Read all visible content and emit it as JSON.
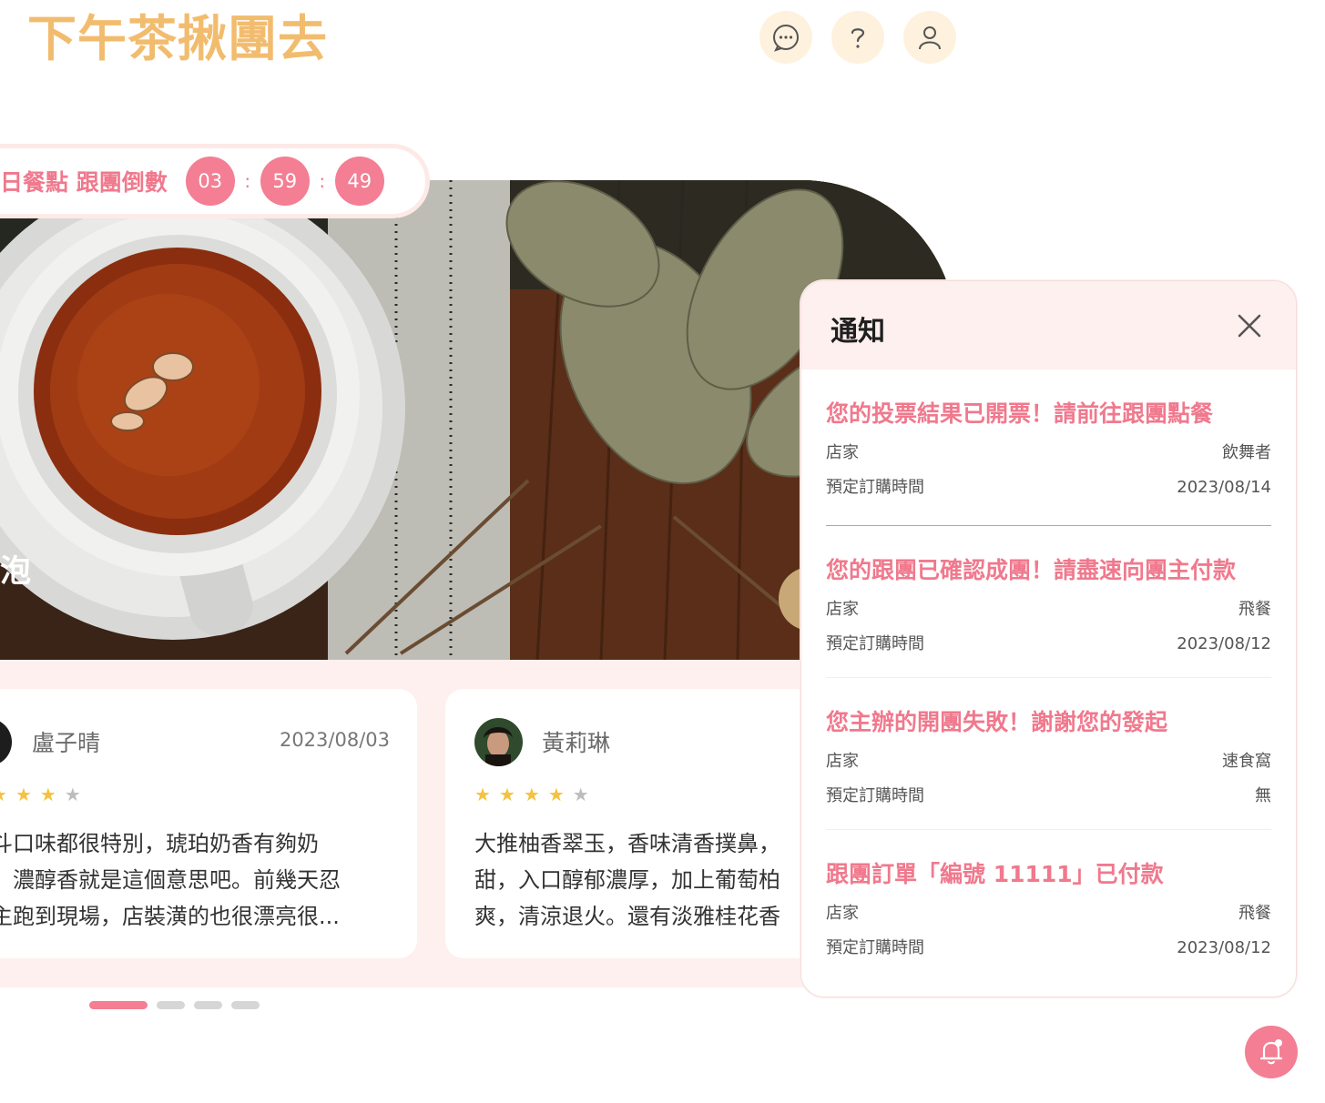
{
  "header": {
    "logo": "下午茶揪團去",
    "icons": [
      "chat-icon",
      "help-icon",
      "user-icon"
    ]
  },
  "hero": {
    "caption": "泡",
    "countdown": {
      "label": "日餐點 跟團倒數",
      "hours": "03",
      "minutes": "59",
      "seconds": "49",
      "separator": ":"
    }
  },
  "reviews": [
    {
      "name": "盧子晴",
      "date": "2023/08/03",
      "rating": 4,
      "lines": [
        "斗口味都很特別，琥珀奶香有夠奶",
        "，濃醇香就是這個意思吧。前幾天忍",
        "主跑到現場，店裝潢的也很漂亮很..."
      ]
    },
    {
      "name": "黃莉琳",
      "date": "",
      "rating": 4,
      "lines": [
        "大推柚香翠玉，香味清香撲鼻，",
        "甜，入口醇郁濃厚，加上葡萄柏",
        "爽，清涼退火。還有淡雅桂花香"
      ]
    }
  ],
  "carousel": {
    "total": 4,
    "active": 0
  },
  "notifications": {
    "title": "通知",
    "items": [
      {
        "title": "您的投票結果已開票！請前往跟團點餐",
        "store_label": "店家",
        "store": "飲舞者",
        "time_label": "預定訂購時間",
        "time": "2023/08/14"
      },
      {
        "title": "您的跟團已確認成團！請盡速向團主付款",
        "store_label": "店家",
        "store": "飛餐",
        "time_label": "預定訂購時間",
        "time": "2023/08/12"
      },
      {
        "title": "您主辦的開團失敗！謝謝您的發起",
        "store_label": "店家",
        "store": "速食窩",
        "time_label": "預定訂購時間",
        "time": "無"
      },
      {
        "title": "跟團訂單「編號 11111」已付款",
        "store_label": "店家",
        "store": "飛餐",
        "time_label": "預定訂購時間",
        "time": "2023/08/12"
      }
    ]
  },
  "colors": {
    "brand": "#F2BC6E",
    "accent": "#F47E93",
    "soft_pink": "#FDF0EE",
    "star": "#F4C23E"
  }
}
